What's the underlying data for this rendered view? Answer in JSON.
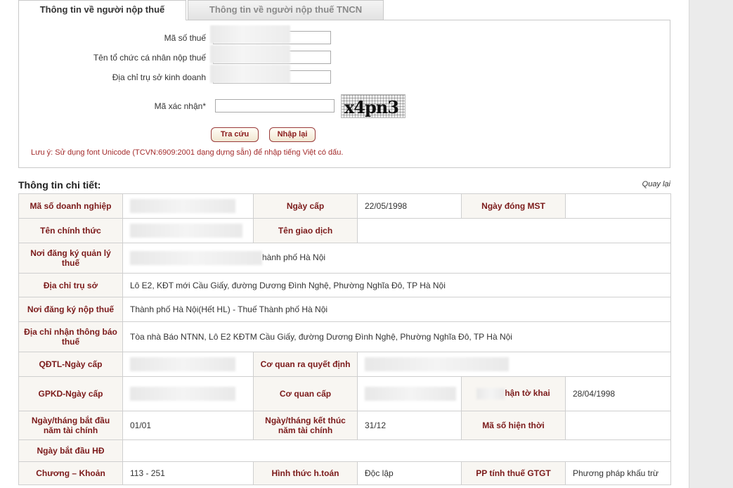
{
  "tabs": {
    "active": "Thông tin về người nộp thuế",
    "inactive": "Thông tin về người nộp thuế TNCN"
  },
  "form": {
    "tax_code_label": "Mã số thuế",
    "name_label": "Tên tổ chức cá nhân nộp thuế",
    "address_label": "Địa chỉ trụ sở kinh doanh",
    "captcha_label": "Mã xác nhận*",
    "captcha_text": "x4pn3",
    "search_button": "Tra cứu",
    "reset_button": "Nhập lại",
    "note": "Lưu ý: Sử dụng font Unicode (TCVN:6909:2001 dạng dựng sẵn) để nhập tiếng Việt có dấu."
  },
  "detail": {
    "title": "Thông tin chi tiết:",
    "back_link": "Quay lại",
    "labels": {
      "enterprise_code": "Mã số doanh nghiệp",
      "issue_date": "Ngày cấp",
      "close_date": "Ngày đóng MST",
      "official_name": "Tên chính thức",
      "trade_name": "Tên giao dịch",
      "mgmt_place": "Nơi đăng ký quản lý thuế",
      "head_office": "Địa chỉ trụ sở",
      "payment_place": "Nơi đăng ký nộp thuế",
      "notice_address": "Địa chỉ nhận thông báo thuế",
      "qdtl": "QĐTL-Ngày cấp",
      "decision_agency": "Cơ quan ra quyết định",
      "gpkd": "GPKD-Ngày cấp",
      "issuing_agency": "Cơ quan cấp",
      "declaration_date_partial": "hận tờ khai",
      "fiscal_start": "Ngày/tháng bắt đầu năm tài chính",
      "fiscal_end": "Ngày/tháng kết thúc năm tài chính",
      "current_code": "Mã số hiện thời",
      "operation_start": "Ngày bắt đầu HĐ",
      "chapter": "Chương – Khoản",
      "accounting": "Hình thức h.toán",
      "vat_method": "PP tính thuế GTGT"
    },
    "values": {
      "issue_date": "22/05/1998",
      "mgmt_place_partial": "hành phố Hà Nội",
      "head_office": "Lô E2, KĐT mới Cầu Giấy, đường Dương Đình Nghệ, Phường Nghĩa Đô, TP Hà Nội",
      "payment_place": "Thành phố Hà Nội(Hết HL) - Thuế Thành phố Hà Nội",
      "notice_address": "Tòa nhà Báo NTNN, Lô E2 KĐTM Cầu Giấy, đường Dương Đình Nghệ, Phường Nghĩa Đô, TP Hà Nội",
      "declaration_date": "28/04/1998",
      "fiscal_start": "01/01",
      "fiscal_end": "31/12",
      "chapter": "113 - 251",
      "accounting": "Độc lập",
      "vat_method": "Phương pháp khấu trừ"
    }
  }
}
